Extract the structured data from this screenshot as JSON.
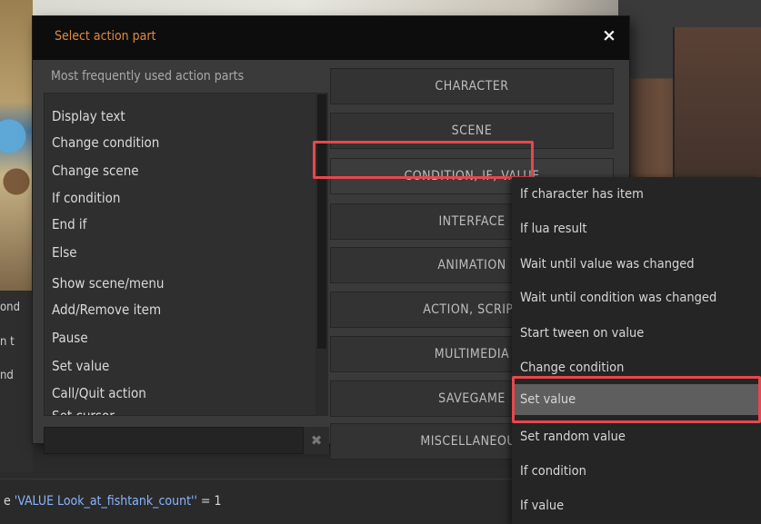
{
  "background": {
    "left_labels": [
      "ond",
      "n t",
      "nd"
    ],
    "status_prefix": "e ",
    "status_value": "'VALUE Look_at_fishtank_count''",
    "status_suffix": " = 1"
  },
  "dialog": {
    "title": "Select action part",
    "close_label": "×",
    "list_caption": "Most frequently used action parts",
    "list_items": [
      "Display text",
      "Change condition",
      "Change scene",
      "If condition",
      "End if",
      "Else",
      "Show scene/menu",
      "Add/Remove item",
      "Pause",
      "Set value",
      "Call/Quit action",
      "Set cursor"
    ],
    "filter_value": "",
    "filter_clear_label": "✖",
    "categories": [
      "CHARACTER",
      "SCENE",
      "CONDITION, IF, VALUE",
      "INTERFACE",
      "ANIMATION",
      "ACTION, SCRIPT",
      "MULTIMEDIA",
      "SAVEGAME",
      "MISCELLANEOUS"
    ],
    "active_category": "CONDITION, IF, VALUE"
  },
  "submenu": {
    "items": [
      "If character has item",
      "If lua result",
      "Wait until value was changed",
      "Wait until condition was changed",
      "Start tween on value",
      "Change condition",
      "Set value",
      "Set random value",
      "If condition",
      "If value"
    ],
    "selected": "Set value"
  },
  "colors": {
    "title": "#e08a3c",
    "highlight": "#e5484d",
    "selected_bg": "#5e5e5e"
  }
}
